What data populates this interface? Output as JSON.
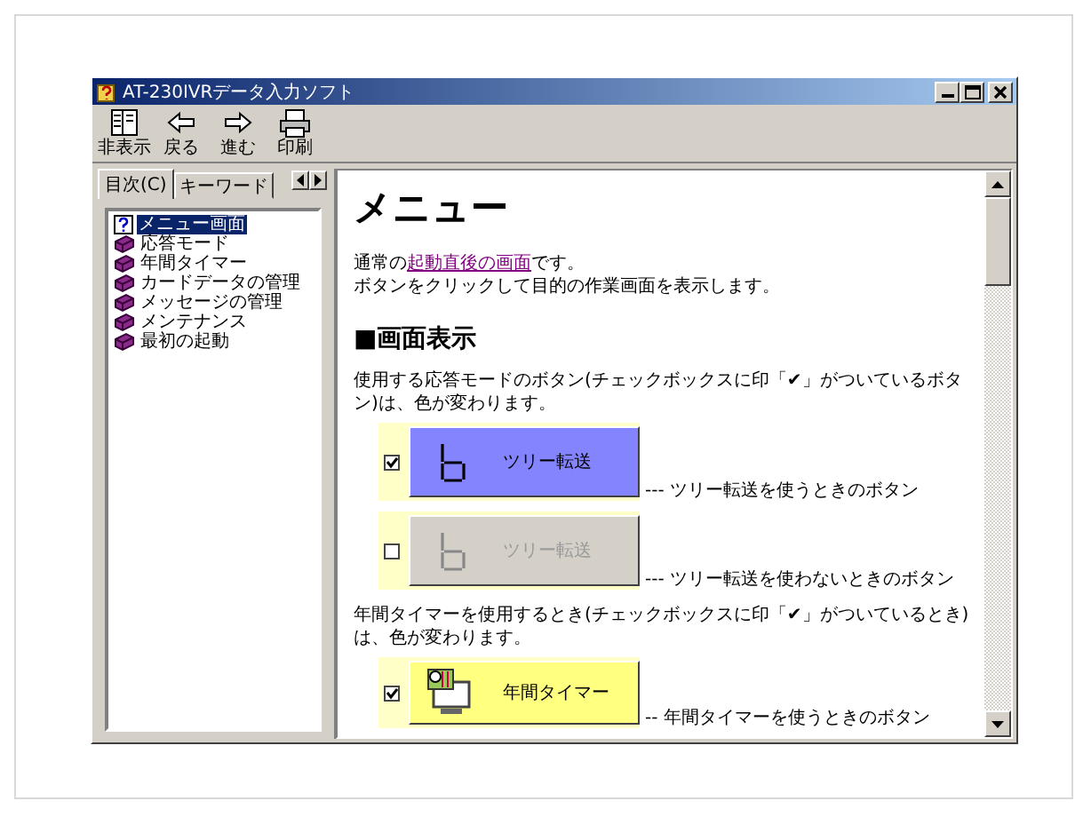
{
  "window": {
    "title": "AT-230IVRデータ入力ソフト"
  },
  "toolbar": [
    {
      "kind": "hide",
      "label": "非表示"
    },
    {
      "kind": "back",
      "label": "戻る"
    },
    {
      "kind": "forward",
      "label": "進む"
    },
    {
      "kind": "print",
      "label": "印刷"
    }
  ],
  "sidebar": {
    "tabs": [
      {
        "label": "目次(C)",
        "selected": true
      },
      {
        "label": "キーワード",
        "selected": false
      }
    ],
    "items": [
      {
        "kind": "page",
        "label": "メニュー画面",
        "selected": true
      },
      {
        "kind": "book",
        "label": "応答モード",
        "selected": false
      },
      {
        "kind": "book",
        "label": "年間タイマー",
        "selected": false
      },
      {
        "kind": "book",
        "label": "カードデータの管理",
        "selected": false
      },
      {
        "kind": "book",
        "label": "メッセージの管理",
        "selected": false
      },
      {
        "kind": "book",
        "label": "メンテナンス",
        "selected": false
      },
      {
        "kind": "book",
        "label": "最初の起動",
        "selected": false
      }
    ]
  },
  "content": {
    "title": "メニュー",
    "intro": {
      "before": "通常の",
      "link": "起動直後の画面",
      "after": "です。"
    },
    "intro_2": "ボタンをクリックして目的の作業画面を表示します。",
    "section_title": "■画面表示",
    "blocks": [
      {
        "kind": "text",
        "text": "使用する応答モードのボタン(チェックボックスに印「✔」がついているボタン)は、色が変わります。"
      },
      {
        "kind": "transfer",
        "checked": true,
        "label": "ツリー転送",
        "caption": "--- ツリー転送を使うときのボタン"
      },
      {
        "kind": "transfer",
        "checked": false,
        "label": "ツリー転送",
        "caption": "--- ツリー転送を使わないときのボタン"
      },
      {
        "kind": "text",
        "text": "年間タイマーを使用するとき(チェックボックスに印「✔」がついているとき)は、色が変わります。"
      },
      {
        "kind": "timer",
        "checked": true,
        "label": "年間タイマー",
        "caption": "-- 年間タイマーを使うときのボタン"
      }
    ]
  }
}
